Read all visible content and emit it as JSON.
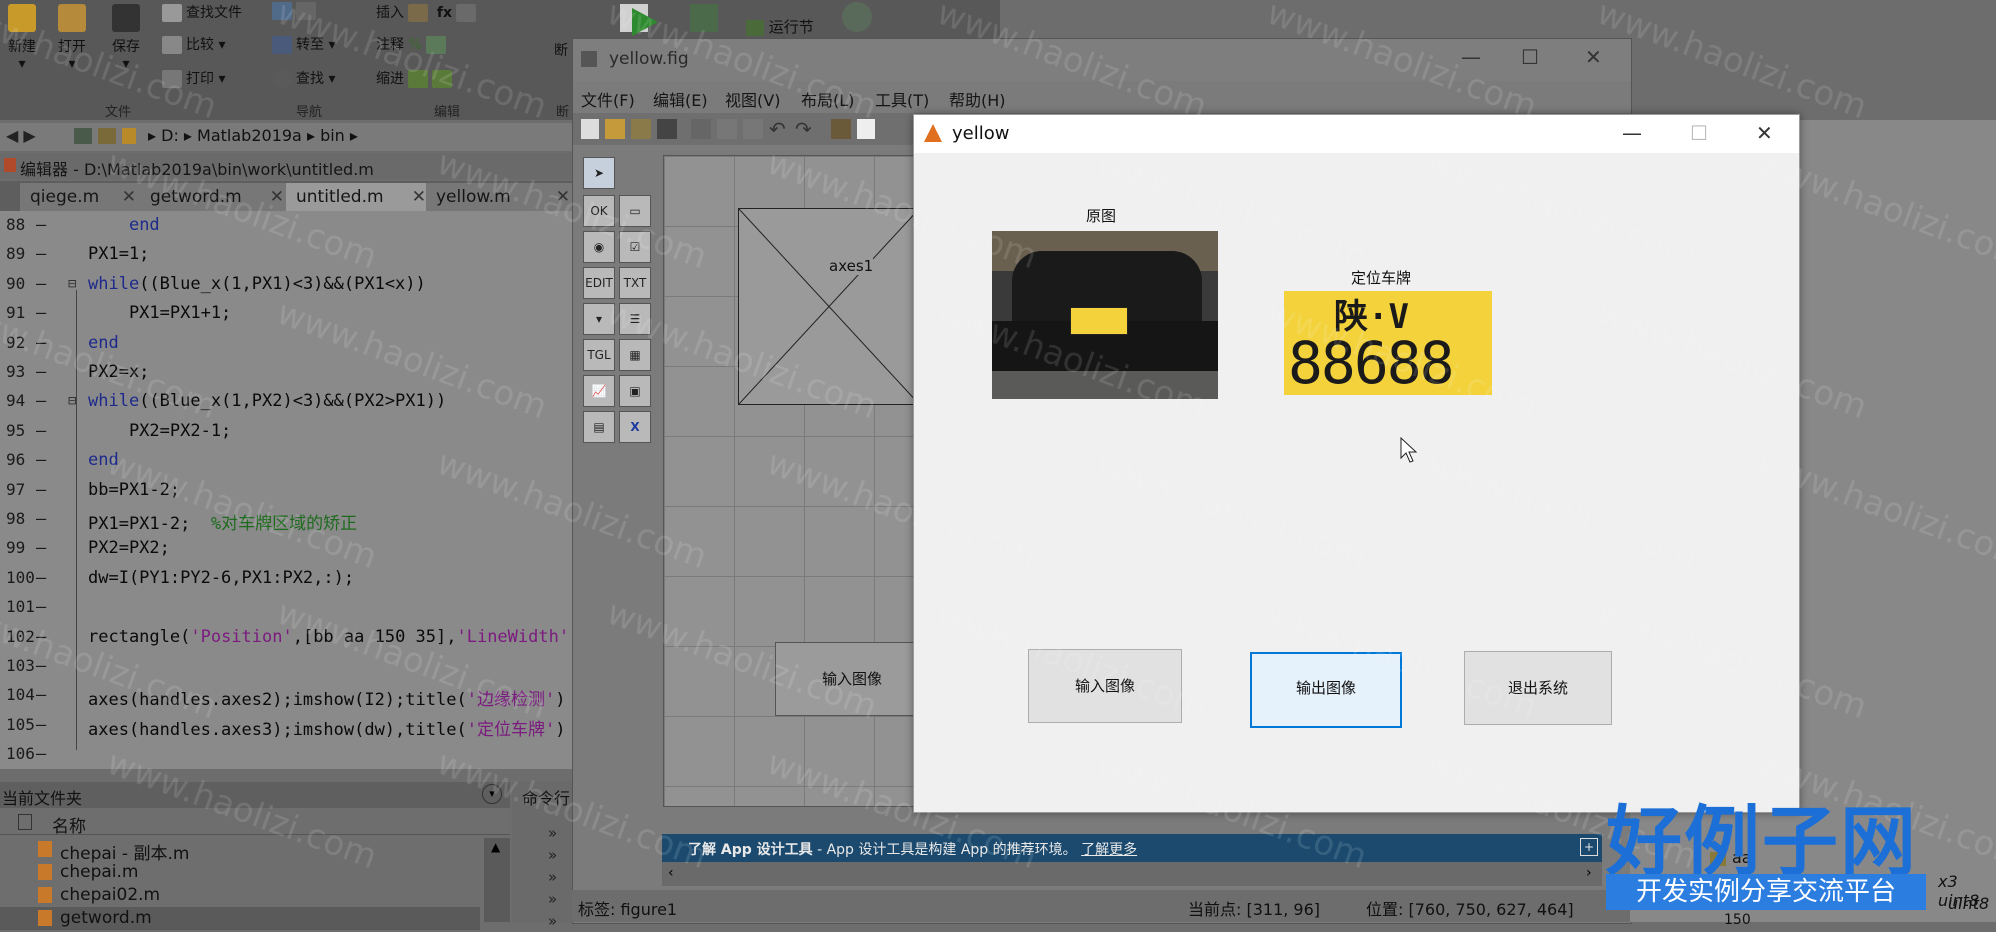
{
  "ribbon": {
    "new_label": "新建",
    "open_label": "打开",
    "save_label": "保存",
    "find_files": "查找文件",
    "compare": "比较",
    "print": "打印",
    "goto": "转至",
    "find": "查找",
    "insert": "插入",
    "comment": "注释",
    "indent": "缩进",
    "break_label": "断",
    "run_section": "运行节",
    "group_file": "文件",
    "group_nav": "导航",
    "group_edit": "编辑",
    "group_break": "断"
  },
  "pathbar": {
    "drive": "D:",
    "folder1": "Matlab2019a",
    "folder2": "bin"
  },
  "editor": {
    "title": "编辑器 - D:\\Matlab2019a\\bin\\work\\untitled.m",
    "tabs": [
      {
        "label": "qiege.m"
      },
      {
        "label": "getword.m"
      },
      {
        "label": "untitled.m"
      },
      {
        "label": "yellow.m"
      }
    ],
    "lines": [
      {
        "n": "88",
        "parts": [
          {
            "t": "    "
          },
          {
            "t": "end",
            "c": "kw"
          }
        ]
      },
      {
        "n": "89",
        "parts": [
          {
            "t": "PX1=1;"
          }
        ]
      },
      {
        "n": "90",
        "parts": [
          {
            "t": "while",
            "c": "kw"
          },
          {
            "t": "((Blue_x(1,PX1)<3)&&(PX1<x))"
          }
        ]
      },
      {
        "n": "91",
        "parts": [
          {
            "t": "    PX1=PX1+1;"
          }
        ]
      },
      {
        "n": "92",
        "parts": [
          {
            "t": "end",
            "c": "kw"
          }
        ]
      },
      {
        "n": "93",
        "parts": [
          {
            "t": "PX2=x;"
          }
        ]
      },
      {
        "n": "94",
        "parts": [
          {
            "t": "while",
            "c": "kw"
          },
          {
            "t": "((Blue_x(1,PX2)<3)&&(PX2>PX1))"
          }
        ]
      },
      {
        "n": "95",
        "parts": [
          {
            "t": "    PX2=PX2-1;"
          }
        ]
      },
      {
        "n": "96",
        "parts": [
          {
            "t": "end",
            "c": "kw"
          }
        ]
      },
      {
        "n": "97",
        "parts": [
          {
            "t": "bb=PX1-2;"
          }
        ]
      },
      {
        "n": "98",
        "parts": [
          {
            "t": "PX1=PX1-2;  "
          },
          {
            "t": "%对车牌区域的矫正",
            "c": "cm"
          }
        ]
      },
      {
        "n": "99",
        "parts": [
          {
            "t": "PX2=PX2;"
          }
        ]
      },
      {
        "n": "100",
        "parts": [
          {
            "t": "dw=I(PY1:PY2-6,PX1:PX2,:);"
          }
        ]
      },
      {
        "n": "101",
        "parts": [
          {
            "t": ""
          }
        ]
      },
      {
        "n": "102",
        "parts": [
          {
            "t": "rectangle("
          },
          {
            "t": "'Position'",
            "c": "str"
          },
          {
            "t": ",[bb aa 150 35],"
          },
          {
            "t": "'LineWidth'",
            "c": "str"
          },
          {
            "t": ","
          }
        ]
      },
      {
        "n": "103",
        "parts": [
          {
            "t": ""
          }
        ]
      },
      {
        "n": "104",
        "parts": [
          {
            "t": "axes(handles.axes2);imshow(I2);title("
          },
          {
            "t": "'边缘检测'",
            "c": "str"
          },
          {
            "t": ")"
          }
        ]
      },
      {
        "n": "105",
        "parts": [
          {
            "t": "axes(handles.axes3);imshow(dw),title("
          },
          {
            "t": "'定位车牌'",
            "c": "str"
          },
          {
            "t": ")"
          }
        ]
      },
      {
        "n": "106",
        "parts": [
          {
            "t": ""
          }
        ]
      }
    ]
  },
  "filepanel": {
    "title": "当前文件夹",
    "col_name": "名称",
    "files": [
      "chepai - 副本.m",
      "chepai.m",
      "chepai02.m",
      "getword.m"
    ]
  },
  "cmdpanel": {
    "title": "命令行"
  },
  "guide": {
    "title": "yellow.fig",
    "menu": [
      "文件(F)",
      "编辑(E)",
      "视图(V)",
      "布局(L)",
      "工具(T)",
      "帮助(H)"
    ],
    "axes_label": "axes1",
    "input_button": "输入图像",
    "info_bold": "了解 App 设计工具",
    "info_text": " - App 设计工具是构建 App 的推荐环境。",
    "info_link": "了解更多",
    "status_tag": "标签: figure1",
    "status_point": "当前点:  [311, 96]",
    "status_position": "位置: [760, 750, 627, 464]"
  },
  "figure": {
    "title": "yellow",
    "orig_title": "原图",
    "plate_title": "定位车牌",
    "plate_top": "陕·V",
    "plate_number": "88688",
    "btn_input": "输入图像",
    "btn_output": "输出图像",
    "btn_exit": "退出系统"
  },
  "right": {
    "var1": "aa",
    "type1": "x3 uint8",
    "type2": "uint8",
    "val": "150"
  },
  "watermark": "www.haolizi.com",
  "brand": {
    "main": "好例子网",
    "sub": "开发实例分享交流平台"
  },
  "colors": {
    "accent": "#0078d7",
    "plate_yellow": "#f3d23b",
    "info_bar": "#1b4a6e"
  }
}
